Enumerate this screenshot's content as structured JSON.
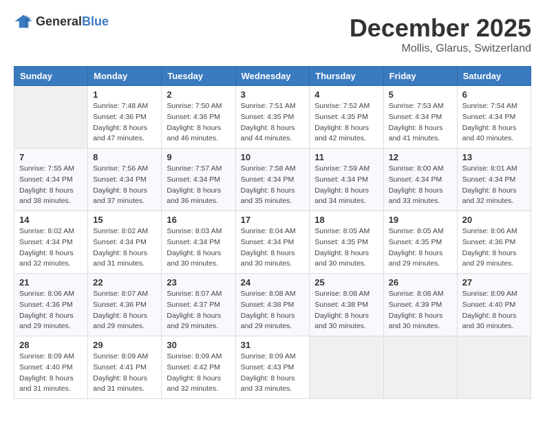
{
  "header": {
    "logo_general": "General",
    "logo_blue": "Blue",
    "month_title": "December 2025",
    "location": "Mollis, Glarus, Switzerland"
  },
  "weekdays": [
    "Sunday",
    "Monday",
    "Tuesday",
    "Wednesday",
    "Thursday",
    "Friday",
    "Saturday"
  ],
  "weeks": [
    [
      {
        "day": "",
        "sunrise": "",
        "sunset": "",
        "daylight": ""
      },
      {
        "day": "1",
        "sunrise": "Sunrise: 7:48 AM",
        "sunset": "Sunset: 4:36 PM",
        "daylight": "Daylight: 8 hours and 47 minutes."
      },
      {
        "day": "2",
        "sunrise": "Sunrise: 7:50 AM",
        "sunset": "Sunset: 4:36 PM",
        "daylight": "Daylight: 8 hours and 46 minutes."
      },
      {
        "day": "3",
        "sunrise": "Sunrise: 7:51 AM",
        "sunset": "Sunset: 4:35 PM",
        "daylight": "Daylight: 8 hours and 44 minutes."
      },
      {
        "day": "4",
        "sunrise": "Sunrise: 7:52 AM",
        "sunset": "Sunset: 4:35 PM",
        "daylight": "Daylight: 8 hours and 42 minutes."
      },
      {
        "day": "5",
        "sunrise": "Sunrise: 7:53 AM",
        "sunset": "Sunset: 4:34 PM",
        "daylight": "Daylight: 8 hours and 41 minutes."
      },
      {
        "day": "6",
        "sunrise": "Sunrise: 7:54 AM",
        "sunset": "Sunset: 4:34 PM",
        "daylight": "Daylight: 8 hours and 40 minutes."
      }
    ],
    [
      {
        "day": "7",
        "sunrise": "Sunrise: 7:55 AM",
        "sunset": "Sunset: 4:34 PM",
        "daylight": "Daylight: 8 hours and 38 minutes."
      },
      {
        "day": "8",
        "sunrise": "Sunrise: 7:56 AM",
        "sunset": "Sunset: 4:34 PM",
        "daylight": "Daylight: 8 hours and 37 minutes."
      },
      {
        "day": "9",
        "sunrise": "Sunrise: 7:57 AM",
        "sunset": "Sunset: 4:34 PM",
        "daylight": "Daylight: 8 hours and 36 minutes."
      },
      {
        "day": "10",
        "sunrise": "Sunrise: 7:58 AM",
        "sunset": "Sunset: 4:34 PM",
        "daylight": "Daylight: 8 hours and 35 minutes."
      },
      {
        "day": "11",
        "sunrise": "Sunrise: 7:59 AM",
        "sunset": "Sunset: 4:34 PM",
        "daylight": "Daylight: 8 hours and 34 minutes."
      },
      {
        "day": "12",
        "sunrise": "Sunrise: 8:00 AM",
        "sunset": "Sunset: 4:34 PM",
        "daylight": "Daylight: 8 hours and 33 minutes."
      },
      {
        "day": "13",
        "sunrise": "Sunrise: 8:01 AM",
        "sunset": "Sunset: 4:34 PM",
        "daylight": "Daylight: 8 hours and 32 minutes."
      }
    ],
    [
      {
        "day": "14",
        "sunrise": "Sunrise: 8:02 AM",
        "sunset": "Sunset: 4:34 PM",
        "daylight": "Daylight: 8 hours and 32 minutes."
      },
      {
        "day": "15",
        "sunrise": "Sunrise: 8:02 AM",
        "sunset": "Sunset: 4:34 PM",
        "daylight": "Daylight: 8 hours and 31 minutes."
      },
      {
        "day": "16",
        "sunrise": "Sunrise: 8:03 AM",
        "sunset": "Sunset: 4:34 PM",
        "daylight": "Daylight: 8 hours and 30 minutes."
      },
      {
        "day": "17",
        "sunrise": "Sunrise: 8:04 AM",
        "sunset": "Sunset: 4:34 PM",
        "daylight": "Daylight: 8 hours and 30 minutes."
      },
      {
        "day": "18",
        "sunrise": "Sunrise: 8:05 AM",
        "sunset": "Sunset: 4:35 PM",
        "daylight": "Daylight: 8 hours and 30 minutes."
      },
      {
        "day": "19",
        "sunrise": "Sunrise: 8:05 AM",
        "sunset": "Sunset: 4:35 PM",
        "daylight": "Daylight: 8 hours and 29 minutes."
      },
      {
        "day": "20",
        "sunrise": "Sunrise: 8:06 AM",
        "sunset": "Sunset: 4:36 PM",
        "daylight": "Daylight: 8 hours and 29 minutes."
      }
    ],
    [
      {
        "day": "21",
        "sunrise": "Sunrise: 8:06 AM",
        "sunset": "Sunset: 4:36 PM",
        "daylight": "Daylight: 8 hours and 29 minutes."
      },
      {
        "day": "22",
        "sunrise": "Sunrise: 8:07 AM",
        "sunset": "Sunset: 4:36 PM",
        "daylight": "Daylight: 8 hours and 29 minutes."
      },
      {
        "day": "23",
        "sunrise": "Sunrise: 8:07 AM",
        "sunset": "Sunset: 4:37 PM",
        "daylight": "Daylight: 8 hours and 29 minutes."
      },
      {
        "day": "24",
        "sunrise": "Sunrise: 8:08 AM",
        "sunset": "Sunset: 4:38 PM",
        "daylight": "Daylight: 8 hours and 29 minutes."
      },
      {
        "day": "25",
        "sunrise": "Sunrise: 8:08 AM",
        "sunset": "Sunset: 4:38 PM",
        "daylight": "Daylight: 8 hours and 30 minutes."
      },
      {
        "day": "26",
        "sunrise": "Sunrise: 8:08 AM",
        "sunset": "Sunset: 4:39 PM",
        "daylight": "Daylight: 8 hours and 30 minutes."
      },
      {
        "day": "27",
        "sunrise": "Sunrise: 8:09 AM",
        "sunset": "Sunset: 4:40 PM",
        "daylight": "Daylight: 8 hours and 30 minutes."
      }
    ],
    [
      {
        "day": "28",
        "sunrise": "Sunrise: 8:09 AM",
        "sunset": "Sunset: 4:40 PM",
        "daylight": "Daylight: 8 hours and 31 minutes."
      },
      {
        "day": "29",
        "sunrise": "Sunrise: 8:09 AM",
        "sunset": "Sunset: 4:41 PM",
        "daylight": "Daylight: 8 hours and 31 minutes."
      },
      {
        "day": "30",
        "sunrise": "Sunrise: 8:09 AM",
        "sunset": "Sunset: 4:42 PM",
        "daylight": "Daylight: 8 hours and 32 minutes."
      },
      {
        "day": "31",
        "sunrise": "Sunrise: 8:09 AM",
        "sunset": "Sunset: 4:43 PM",
        "daylight": "Daylight: 8 hours and 33 minutes."
      },
      {
        "day": "",
        "sunrise": "",
        "sunset": "",
        "daylight": ""
      },
      {
        "day": "",
        "sunrise": "",
        "sunset": "",
        "daylight": ""
      },
      {
        "day": "",
        "sunrise": "",
        "sunset": "",
        "daylight": ""
      }
    ]
  ]
}
